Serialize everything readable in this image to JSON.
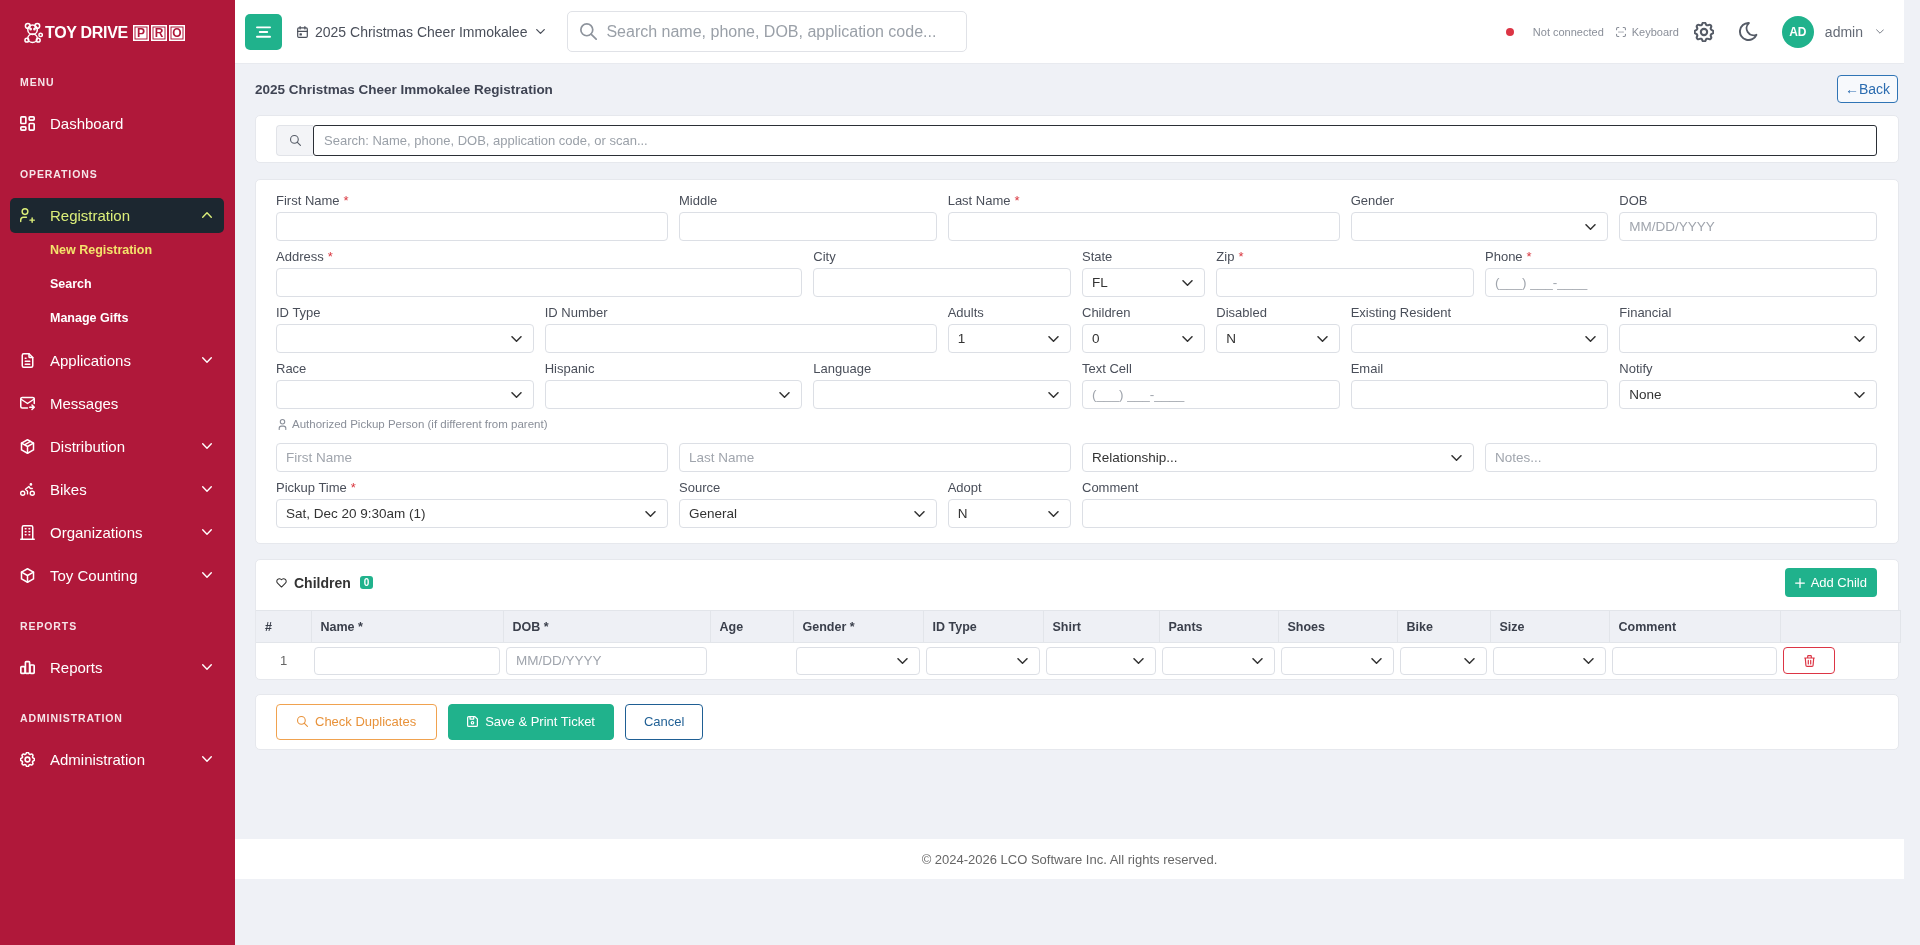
{
  "sidebar": {
    "logo": {
      "text": "TOY DRIVE",
      "boxed_letters": [
        "P",
        "R",
        "O"
      ]
    },
    "sections": [
      {
        "heading": "MENU",
        "items": [
          {
            "label": "Dashboard",
            "kind": "link",
            "selected": false
          }
        ]
      },
      {
        "heading": "OPERATIONS",
        "items": [
          {
            "label": "Registration",
            "kind": "group",
            "selected": true,
            "expanded": true,
            "children": [
              {
                "label": "New Registration",
                "selected": true
              },
              {
                "label": "Search",
                "selected": false
              },
              {
                "label": "Manage Gifts",
                "selected": false
              }
            ]
          },
          {
            "label": "Applications",
            "kind": "group",
            "selected": false,
            "expanded": false
          },
          {
            "label": "Messages",
            "kind": "link",
            "selected": false
          },
          {
            "label": "Distribution",
            "kind": "group",
            "selected": false,
            "expanded": false
          },
          {
            "label": "Bikes",
            "kind": "group",
            "selected": false,
            "expanded": false
          },
          {
            "label": "Organizations",
            "kind": "group",
            "selected": false,
            "expanded": false
          },
          {
            "label": "Toy Counting",
            "kind": "group",
            "selected": false,
            "expanded": false
          }
        ]
      },
      {
        "heading": "REPORTS",
        "items": [
          {
            "label": "Reports",
            "kind": "group",
            "selected": false,
            "expanded": false
          }
        ]
      },
      {
        "heading": "ADMINISTRATION",
        "items": [
          {
            "label": "Administration",
            "kind": "group",
            "selected": false,
            "expanded": false
          }
        ]
      }
    ]
  },
  "topbar": {
    "event": "2025 Christmas Cheer Immokalee",
    "search": {
      "placeholder": "Search name, phone, DOB, application code..."
    },
    "connection": {
      "connected": false,
      "label": "Not connected"
    },
    "keyboard": {
      "label": "Keyboard"
    },
    "user": {
      "initials": "AD",
      "name": "admin"
    }
  },
  "page": {
    "title": "2025 Christmas Cheer Immokalee Registration",
    "back_button": "←Back"
  },
  "quick_search": {
    "placeholder": "Search: Name, phone, DOB, application code, or scan...",
    "focused": true
  },
  "form": {
    "rows": [
      {
        "fields": [
          {
            "label": "First Name",
            "marker": "*",
            "kind": "text"
          },
          {
            "label": "Middle",
            "kind": "text"
          },
          {
            "label": "Last Name",
            "marker": "*",
            "kind": "text"
          },
          {
            "label": "Gender",
            "kind": "select"
          },
          {
            "label": "DOB",
            "kind": "text",
            "placeholder": "MM/DD/YYYY"
          }
        ]
      },
      {
        "fields": [
          {
            "label": "Address",
            "marker": "*",
            "kind": "text"
          },
          {
            "label": "City",
            "kind": "text"
          },
          {
            "label": "State",
            "kind": "select",
            "value": "FL"
          },
          {
            "label": "Zip",
            "marker": "*",
            "kind": "text"
          },
          {
            "label": "Phone",
            "marker": "*",
            "kind": "text",
            "placeholder": "(___) ___-____"
          }
        ]
      },
      {
        "fields": [
          {
            "label": "ID Type",
            "kind": "select"
          },
          {
            "label": "ID Number",
            "kind": "text"
          },
          {
            "label": "Adults",
            "kind": "select",
            "value": "1"
          },
          {
            "label": "Children",
            "kind": "select",
            "value": "0"
          },
          {
            "label": "Disabled",
            "kind": "select",
            "value": "N"
          },
          {
            "label": "Existing Resident",
            "kind": "select"
          },
          {
            "label": "Financial",
            "kind": "select"
          }
        ]
      },
      {
        "fields": [
          {
            "label": "Race",
            "kind": "select"
          },
          {
            "label": "Hispanic",
            "kind": "select"
          },
          {
            "label": "Language",
            "kind": "select"
          },
          {
            "label": "Text Cell",
            "kind": "text",
            "placeholder": "(___) ___-____"
          },
          {
            "label": "Email",
            "kind": "text"
          },
          {
            "label": "Notify",
            "kind": "select",
            "value": "None"
          }
        ]
      }
    ],
    "pickup": {
      "heading": "Authorized Pickup Person (if different from parent)",
      "fields": [
        {
          "kind": "text",
          "placeholder": "First Name"
        },
        {
          "kind": "text",
          "placeholder": "Last Name"
        },
        {
          "kind": "select",
          "value": "Relationship..."
        },
        {
          "kind": "text",
          "placeholder": "Notes..."
        }
      ]
    },
    "final_row": {
      "fields": [
        {
          "label": "Pickup Time",
          "marker": "*",
          "kind": "select",
          "value": "Sat, Dec 20 9:30am (1)"
        },
        {
          "label": "Source",
          "kind": "select",
          "value": "General"
        },
        {
          "label": "Adopt",
          "kind": "select",
          "value": "N"
        },
        {
          "label": "Comment",
          "kind": "text"
        }
      ]
    }
  },
  "children": {
    "title": "Children",
    "count": "0",
    "add_button": "Add Child",
    "columns": [
      "#",
      "Name *",
      "DOB *",
      "Age",
      "Gender *",
      "ID Type",
      "Shirt",
      "Pants",
      "Shoes",
      "Bike",
      "Size",
      "Comment"
    ],
    "rows": [
      {
        "cells": [
          {
            "kind": "number",
            "text": "1"
          },
          {
            "kind": "input"
          },
          {
            "kind": "input",
            "placeholder": "MM/DD/YYYY"
          },
          {
            "kind": "blank"
          },
          {
            "kind": "select"
          },
          {
            "kind": "select"
          },
          {
            "kind": "select"
          },
          {
            "kind": "select"
          },
          {
            "kind": "select"
          },
          {
            "kind": "select"
          },
          {
            "kind": "select"
          },
          {
            "kind": "input"
          },
          {
            "kind": "delete"
          }
        ]
      }
    ]
  },
  "actions": [
    {
      "label": "Check Duplicates",
      "kind": "warning"
    },
    {
      "label": "Save & Print Ticket",
      "kind": "primary"
    },
    {
      "label": "Cancel",
      "kind": "secondary"
    }
  ],
  "footer": "© 2024-2026 LCO Software Inc. All rights reserved."
}
